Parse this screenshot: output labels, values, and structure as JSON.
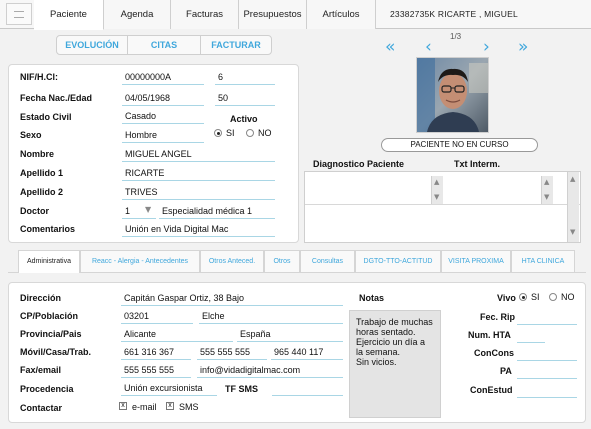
{
  "top_tabs": [
    "Paciente",
    "Agenda",
    "Facturas",
    "Presupuestos",
    "Artículos"
  ],
  "patient_title": "23382735K    RICARTE , MIGUEL",
  "segments": [
    "EVOLUCIÓN",
    "CITAS",
    "FACTURAR"
  ],
  "nav": {
    "first": "«",
    "prev": "‹",
    "next": "›",
    "last": "»",
    "counter": "1/3"
  },
  "info": {
    "nif_label": "NIF/H.Cl:",
    "nif": "00000000A",
    "hcl": "6",
    "birth_label": "Fecha Nac./Edad",
    "birth": "04/05/1968",
    "age": "50",
    "civil_label": "Estado Civil",
    "civil": "Casado",
    "active_label": "Activo",
    "active_yes": "SI",
    "active_no": "NO",
    "sex_label": "Sexo",
    "sex": "Hombre",
    "name_label": "Nombre",
    "name": "MIGUEL ANGEL",
    "surname1_label": "Apellido 1",
    "surname1": "RICARTE",
    "surname2_label": "Apellido 2",
    "surname2": "TRIVES",
    "doctor_label": "Doctor",
    "doctor_id": "1",
    "doctor_spec": "Especialidad médica 1",
    "comments_label": "Comentarios",
    "comments": "Unión en Vida Digital Mac"
  },
  "status_button": "PACIENTE NO EN CURSO",
  "diag": {
    "patient_label": "Diagnostico Paciente",
    "interm_label": "Txt Interm."
  },
  "bottom_tabs": [
    "Administrativa",
    "Reacc - Alergia - Antecedentes",
    "Otros Anteced.",
    "Otros",
    "Consultas",
    "DGTO-TTO-ACTITUD",
    "VISITA PROXIMA",
    "HTA CLINICA"
  ],
  "detail": {
    "address_label": "Dirección",
    "address": "Capitán Gaspar Ortiz, 38 Bajo",
    "cp_label": "CP/Población",
    "cp": "03201",
    "town": "Elche",
    "prov_label": "Provincia/Pais",
    "province": "Alicante",
    "country": "España",
    "phones_label": "Móvil/Casa/Trab.",
    "mobile": "661 316 367",
    "home": "555 555 555",
    "work": "965 440 117",
    "fax_label": "Fax/email",
    "fax": "555 555 555",
    "email": "info@vidadigitalmac.com",
    "origin_label": "Procedencia",
    "origin": "Unión excursionista",
    "sms_label": "TF SMS",
    "contact_label": "Contactar",
    "contact_email": "e-mail",
    "contact_sms": "SMS",
    "notes_label": "Notas",
    "notes": "Trabajo de muchas horas sentado.\nEjercicio un día a la semana.\nSin vicios.",
    "alive_label": "Vivo",
    "alive_yes": "SI",
    "alive_no": "NO",
    "rip_label": "Fec. Rip",
    "hta_label": "Num. HTA",
    "concons_label": "ConCons",
    "pa_label": "PA",
    "conestud_label": "ConEstud"
  }
}
